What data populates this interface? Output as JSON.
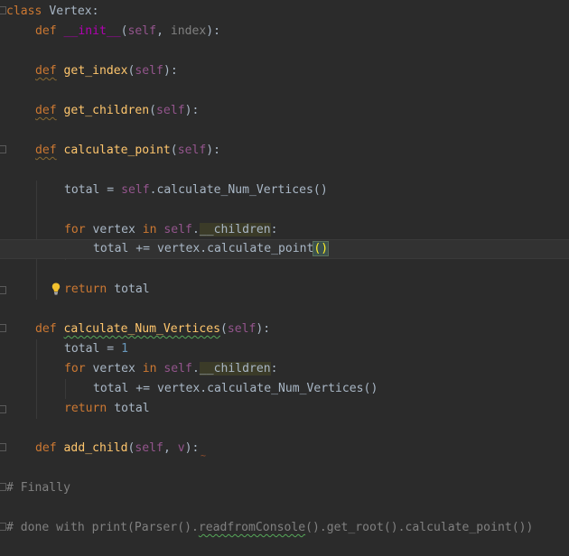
{
  "lines": {
    "l1": {
      "kw": "class",
      "name": "Vertex",
      "colon": ":"
    },
    "l2": {
      "kw": "def",
      "fn": "__init__",
      "open": "(",
      "self": "self",
      "sep": ", ",
      "param": "index",
      "close": "):"
    },
    "l4": {
      "kw": "def",
      "fn": "get_index",
      "open": "(",
      "self": "self",
      "close": "):"
    },
    "l6": {
      "kw": "def",
      "fn": "get_children",
      "open": "(",
      "self": "self",
      "close": "):"
    },
    "l8": {
      "kw": "def",
      "fn": "calculate_point",
      "open": "(",
      "self": "self",
      "close": "):"
    },
    "l10": {
      "lhs": "total = ",
      "self": "self",
      "rest": ".calculate_Num_Vertices()"
    },
    "l12": {
      "kw": "for",
      "var": " vertex ",
      "kw2": "in",
      "self": " self",
      "dot": ".",
      "attr": "__children",
      "colon": ":"
    },
    "l13": {
      "text": "total += vertex.calculate_point",
      "paren": "()"
    },
    "l15": {
      "kw": "return",
      "rest": " total"
    },
    "l17": {
      "kw": "def",
      "fn": "calculate_Num_Vertices",
      "open": "(",
      "self": "self",
      "close": "):"
    },
    "l18": {
      "lhs": "total = ",
      "num": "1"
    },
    "l19": {
      "kw": "for",
      "var": " vertex ",
      "kw2": "in",
      "self": " self",
      "dot": ".",
      "attr": "__children",
      "colon": ":"
    },
    "l20": {
      "text": "total += vertex.calculate_Num_Vertices()"
    },
    "l21": {
      "kw": "return",
      "rest": " total"
    },
    "l23": {
      "kw": "def",
      "fn": "add_child",
      "open": "(",
      "self": "self",
      "sep": ", ",
      "param": "v",
      "close": "):"
    },
    "l25": {
      "comment": "# Finally"
    },
    "l27": {
      "prefix": "# done with print(Parser().",
      "underlined": "readfromConsole",
      "suffix": "().get_root().calculate_point())"
    }
  },
  "icons": {
    "intention": "lightbulb-icon"
  },
  "colors": {
    "background": "#2b2b2b",
    "keyword": "#cc7832",
    "function": "#ffc66d",
    "self": "#94558d",
    "dunder": "#b200b2",
    "number": "#6897bb",
    "comment": "#808080",
    "text": "#a9b7c6"
  }
}
